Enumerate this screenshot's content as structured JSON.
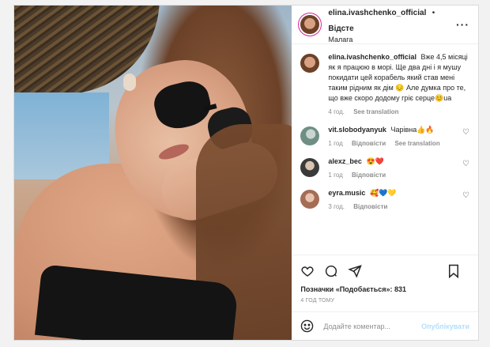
{
  "post": {
    "username": "elina.ivashchenko_official",
    "follow": "Відсте",
    "location": "Малага",
    "caption": {
      "username": "elina.ivashchenko_official",
      "text": "Вже 4,5 місяці як я працюю в морі. Ще два дні і я мушу покидати цей корабель який став мені таким рідним як дім 😔 Але думка про те, що вже скоро додому гріє серце😊ua",
      "age": "4 год.",
      "translate": "See translation"
    },
    "comments": [
      {
        "username": "vit.slobodyanyuk",
        "text": "Чарівна👍🔥",
        "age": "1 год",
        "reply": "Відповісти",
        "translate": "See translation"
      },
      {
        "username": "alexz_bec",
        "text": "😍❤️",
        "age": "1 год",
        "reply": "Відповісти"
      },
      {
        "username": "eyra.music",
        "text": "🥰💙💛",
        "age": "3 год.",
        "reply": "Відповісти"
      }
    ],
    "likes": "Позначки «Подобається»: 831",
    "posted": "4 ГОД ТОМУ",
    "add_comment_placeholder": "Додайте коментар...",
    "publish": "Опублікувати"
  },
  "icons": [
    "more-icon",
    "heart-icon",
    "comment-icon",
    "share-icon",
    "bookmark-icon",
    "emoji-icon"
  ],
  "colors": {
    "accent_blue": "#0095f6",
    "publish_disabled": "#b2dffc",
    "muted": "#8e8e8e"
  }
}
